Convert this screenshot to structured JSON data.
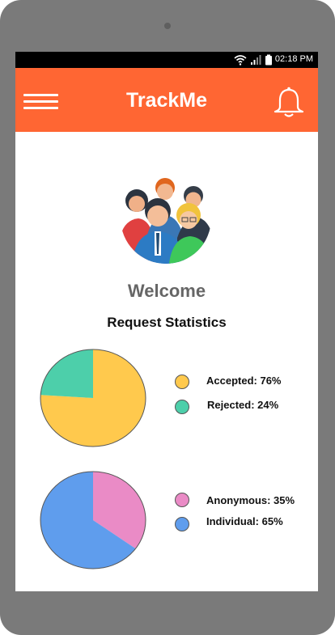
{
  "status_bar": {
    "time": "02:18 PM"
  },
  "app_bar": {
    "title": "TrackMe"
  },
  "welcome": "Welcome",
  "section_title": "Request Statistics",
  "chart_data": [
    {
      "type": "pie",
      "categories": [
        "Accepted",
        "Rejected"
      ],
      "values": [
        76,
        24
      ],
      "colors": [
        "#ffc94d",
        "#4dcfaa"
      ],
      "legend": [
        "Accepted: 76%",
        "Rejected: 24%"
      ]
    },
    {
      "type": "pie",
      "categories": [
        "Anonymous",
        "Individual"
      ],
      "values": [
        35,
        65
      ],
      "colors": [
        "#ea8bc6",
        "#5f9ded"
      ],
      "legend": [
        "Anonymous: 35%",
        "Individual: 65%"
      ]
    }
  ]
}
